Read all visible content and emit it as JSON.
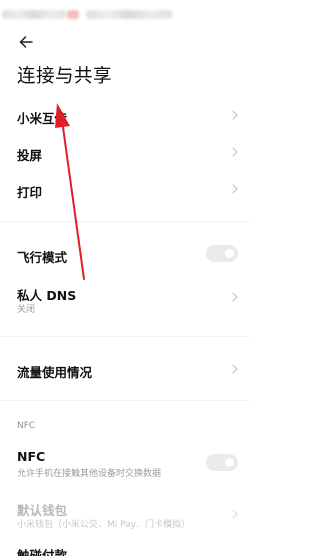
{
  "header": {
    "title": "连接与共享"
  },
  "rows": {
    "mi_share": {
      "label": "小米互传"
    },
    "cast": {
      "label": "投屏"
    },
    "print": {
      "label": "打印"
    },
    "airplane": {
      "label": "飞行模式",
      "enabled": false
    },
    "private_dns": {
      "label": "私人 DNS",
      "sub": "关闭"
    },
    "data_usage": {
      "label": "流量使用情况"
    },
    "nfc_section": {
      "title": "NFC"
    },
    "nfc": {
      "label": "NFC",
      "sub": "允许手机在接触其他设备时交换数据",
      "enabled": false
    },
    "default_wallet": {
      "label": "默认钱包",
      "sub": "小米钱包（小米公交、Mi Pay、门卡模拟）"
    },
    "tap_pay": {
      "label": "触碰付款"
    }
  },
  "colors": {
    "annotation_arrow": "#e11d2a",
    "toggle_off": "#ebebeb",
    "secondary_text": "#9b9b9b"
  }
}
